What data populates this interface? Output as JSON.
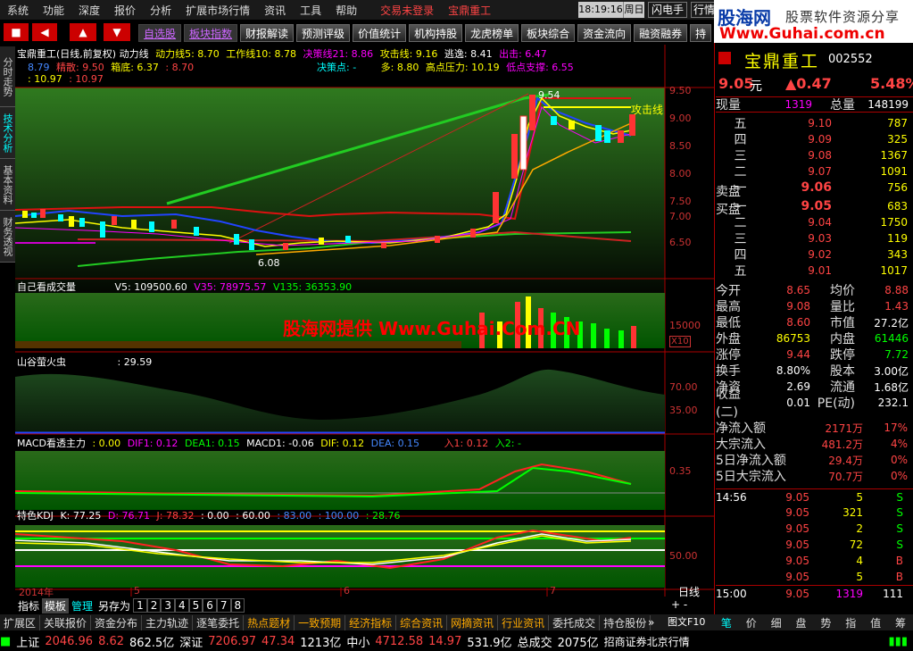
{
  "menu": [
    "系统",
    "功能",
    "深度",
    "报价",
    "分析",
    "扩展市场行情",
    "资讯",
    "工具",
    "帮助"
  ],
  "menu_status": [
    "交易未登录",
    "宝鼎重工"
  ],
  "clock": "18:19:16",
  "weekday": "周日",
  "flash_btn": "闪电手",
  "quote_btn": "行情",
  "brand": {
    "title": "股海网",
    "subtitle": "股票软件资源分享",
    "url": "Www.Guhai.com.cn"
  },
  "toolbar": [
    "自选股",
    "板块指数",
    "财报解读",
    "预测评级",
    "价值统计",
    "机构持股",
    "龙虎榜单",
    "板块综合",
    "资金流向",
    "融资融券",
    "持"
  ],
  "side_tabs": [
    "分时走势",
    "技术分析",
    "基本资料",
    "财务透视"
  ],
  "main_panel": {
    "title": "宝鼎重工(日线,前复权) 动力线",
    "legend1": [
      "动力线5: 8.70",
      "工作线10: 8.78",
      "决策线21: 8.86",
      "攻击线: 9.16",
      "逃逸: 8.41",
      "出击: 6.47"
    ],
    "legend2": [
      "8.79",
      "精散: 9.50",
      "箱底: 6.37",
      ": 8.70"
    ],
    "legend2b": [
      "决策点: -",
      "多: 8.80",
      "高点压力: 10.19",
      "低点支撑: 6.55"
    ],
    "legend3": [
      ": 10.97",
      ": 10.97"
    ],
    "yticks": [
      "9.50",
      "9.00",
      "8.50",
      "8.00",
      "7.50",
      "7.00",
      "6.50"
    ],
    "annotations": {
      "high": "9.54",
      "low": "6.08",
      "attack": "攻击线"
    }
  },
  "vol_panel": {
    "title": "自己看成交量",
    "legend": [
      "V5: 109500.60",
      "V35: 78975.57",
      "V135: 36353.90"
    ],
    "ytick": "15000",
    "unit": "X10"
  },
  "watermark": "股海网提供 Www.Guhai.Com.CN",
  "firefly_panel": {
    "title": "山谷萤火虫",
    "legend": [
      ": 29.59"
    ],
    "yticks": [
      "70.00",
      "35.00"
    ]
  },
  "macd_panel": {
    "title": "MACD看透主力",
    "legend": [
      ": 0.00",
      "DIF1: 0.12",
      "DEA1: 0.15",
      "MACD1: -0.06",
      "DIF: 0.12",
      "DEA: 0.15",
      "入1: 0.12",
      "入2: -"
    ],
    "ytick": "0.35"
  },
  "kdj_panel": {
    "title": "特色KDJ",
    "legend": [
      "K: 77.25",
      "D: 76.71",
      "J: 78.32",
      ": 0.00",
      ": 60.00",
      ": 83.00",
      ": 100.00",
      ": 28.76"
    ],
    "ytick": "50.00"
  },
  "x_axis": {
    "labels": [
      "2014年",
      "5",
      "6",
      "7"
    ],
    "period": "日线"
  },
  "indicator_tabs": [
    "指标",
    "模板",
    "管理",
    "另存为",
    "1",
    "2",
    "3",
    "4",
    "5",
    "6",
    "7",
    "8"
  ],
  "quote": {
    "name": "宝鼎重工",
    "code": "002552",
    "price": "9.05",
    "unit": "元",
    "change": "▲0.47",
    "pct": "5.48%",
    "current_label": "现量",
    "current": "1319",
    "total_label": "总量",
    "total": "148199",
    "sells": [
      [
        "五",
        "9.10",
        "787"
      ],
      [
        "四",
        "9.09",
        "325"
      ],
      [
        "三",
        "9.08",
        "1367"
      ],
      [
        "二",
        "9.07",
        "1091"
      ],
      [
        "一",
        "9.06",
        "756"
      ]
    ],
    "sell_label": "卖盘",
    "buy_label": "买盘",
    "buys": [
      [
        "一",
        "9.05",
        "683"
      ],
      [
        "二",
        "9.04",
        "1750"
      ],
      [
        "三",
        "9.03",
        "119"
      ],
      [
        "四",
        "9.02",
        "343"
      ],
      [
        "五",
        "9.01",
        "1017"
      ]
    ],
    "stats": [
      [
        "今开",
        "8.65",
        "均价",
        "8.88"
      ],
      [
        "最高",
        "9.08",
        "量比",
        "1.43"
      ],
      [
        "最低",
        "8.60",
        "市值",
        "27.2亿"
      ],
      [
        "外盘",
        "86753",
        "内盘",
        "61446"
      ],
      [
        "涨停",
        "9.44",
        "跌停",
        "7.72"
      ],
      [
        "换手",
        "8.80%",
        "股本",
        "3.00亿"
      ],
      [
        "净资",
        "2.69",
        "流通",
        "1.68亿"
      ],
      [
        "收益(二)",
        "0.01",
        "PE(动)",
        "232.1"
      ]
    ],
    "flows": [
      [
        "净流入额",
        "2171万",
        "17%"
      ],
      [
        "大宗流入",
        "481.2万",
        "4%"
      ],
      [
        "5日净流入额",
        "29.4万",
        "0%"
      ],
      [
        "5日大宗流入",
        "70.7万",
        "0%"
      ]
    ],
    "ticks": [
      [
        "14:56",
        "9.05",
        "5",
        "S"
      ],
      [
        "",
        "9.05",
        "321",
        "S"
      ],
      [
        "",
        "9.05",
        "2",
        "S"
      ],
      [
        "",
        "9.05",
        "72",
        "S"
      ],
      [
        "",
        "9.05",
        "4",
        "B"
      ],
      [
        "",
        "9.05",
        "5",
        "B"
      ],
      [
        "15:00",
        "9.05",
        "1319",
        "111"
      ]
    ],
    "bottom_tabs": [
      "笔",
      "价",
      "细",
      "盘",
      "势",
      "指",
      "值",
      "筹"
    ]
  },
  "bottom_bar": [
    "扩展区",
    "关联报价",
    "资金分布",
    "主力轨迹",
    "逐笔委托",
    "热点题材",
    "一致预期",
    "经济指标",
    "综合资讯",
    "网摘资讯",
    "行业资讯",
    "委托成交",
    "持仓股份"
  ],
  "bottom_bar_right": "图文F10",
  "status": {
    "sh_label": "上证",
    "sh": "2046.96",
    "sh_chg": "8.62",
    "sh_amt": "862.5亿",
    "sz_label": "深证",
    "sz": "7206.97",
    "sz_chg": "47.34",
    "sz_amt": "1213亿",
    "zx_label": "中小",
    "zx": "4712.58",
    "zx_chg": "14.97",
    "zx_amt": "531.9亿",
    "total_label": "总成交",
    "total": "2075亿",
    "broker": "招商证券北京行情"
  }
}
